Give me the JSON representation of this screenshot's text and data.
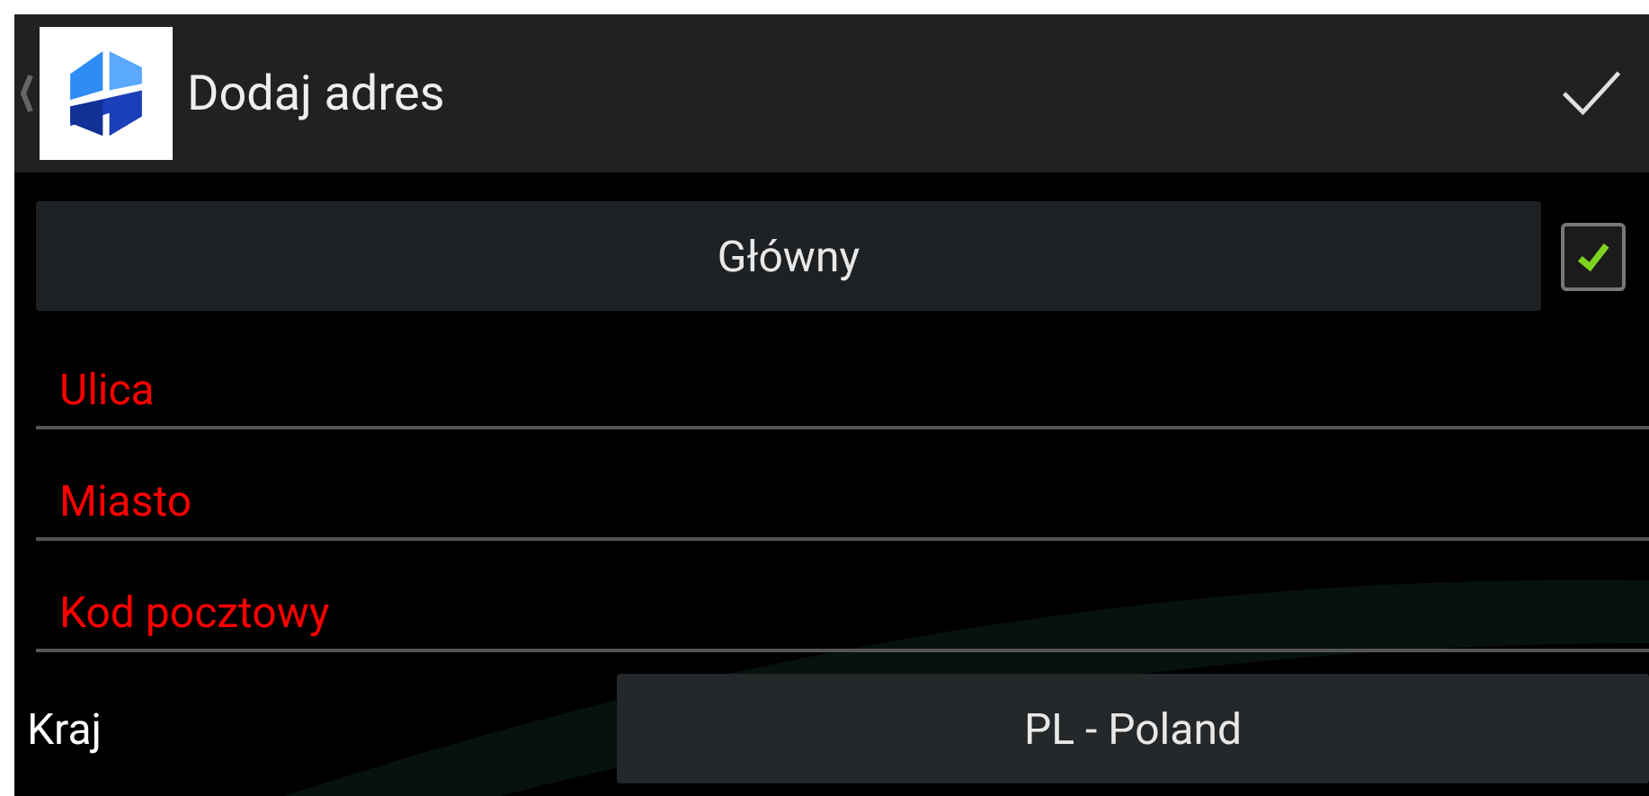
{
  "app_bar": {
    "title": "Dodaj adres"
  },
  "main_toggle": {
    "label": "Główny",
    "checked": true
  },
  "fields": [
    {
      "placeholder": "Ulica"
    },
    {
      "placeholder": "Miasto"
    },
    {
      "placeholder": "Kod pocztowy"
    }
  ],
  "country": {
    "label": "Kraj",
    "value": "PL - Poland"
  }
}
